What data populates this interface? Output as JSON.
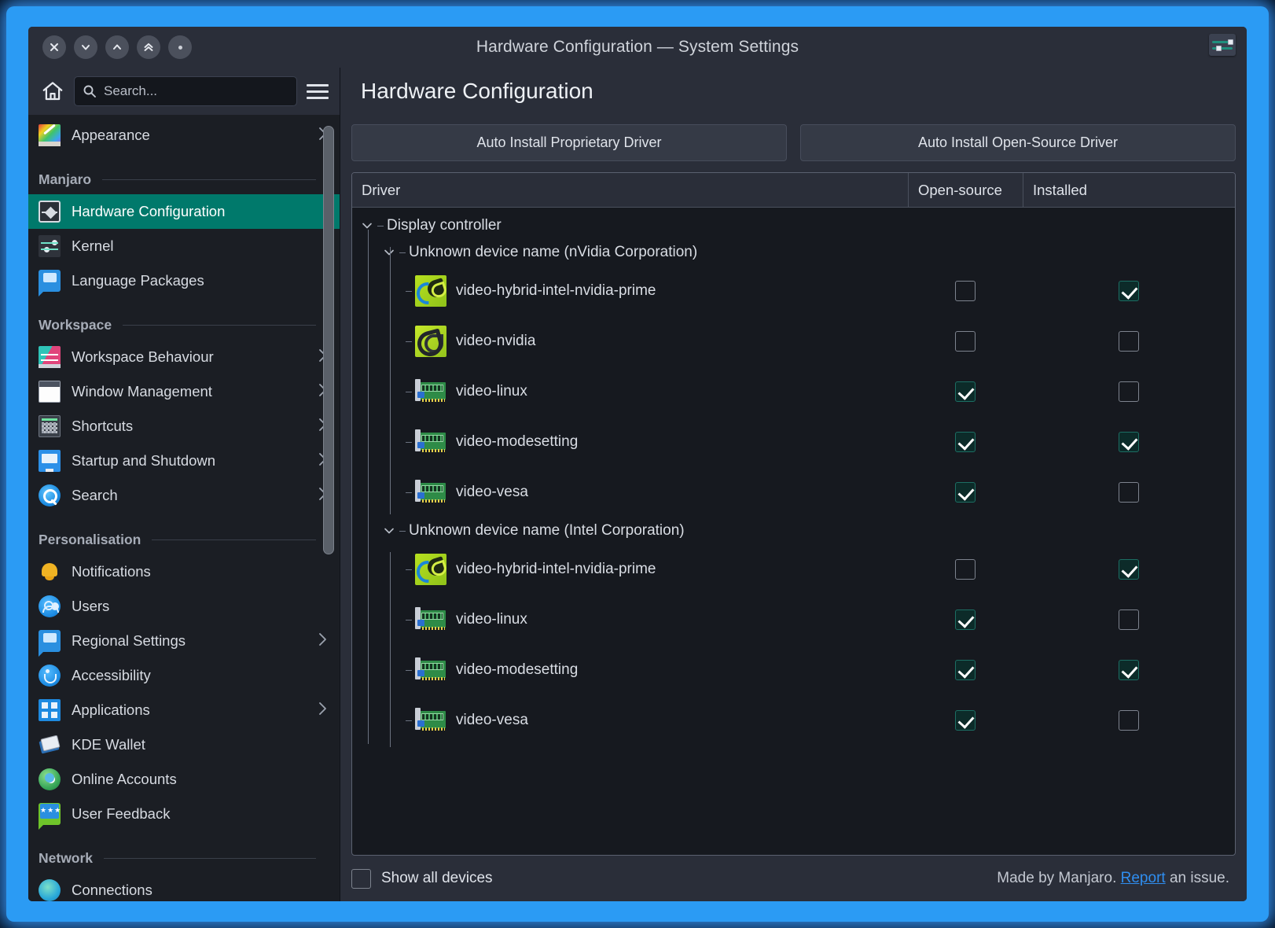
{
  "window": {
    "title": "Hardware Configuration — System Settings",
    "titlebar_buttons": [
      {
        "name": "close-button",
        "glyph": "close-icon"
      },
      {
        "name": "minimize-button",
        "glyph": "chevron-down-icon"
      },
      {
        "name": "maximize-button",
        "glyph": "chevron-up-icon"
      },
      {
        "name": "shade-button",
        "glyph": "double-chevron-up-icon"
      },
      {
        "name": "menu-button",
        "glyph": "dot-icon"
      }
    ],
    "config_icon": "sliders-icon"
  },
  "sidebar": {
    "home_icon": "home-icon",
    "search": {
      "placeholder": "Search...",
      "value": "",
      "icon": "search-icon"
    },
    "menu_icon": "hamburger-icon",
    "sections": [
      {
        "title": "",
        "items": [
          {
            "label": "Appearance",
            "icon": "appearance-icon",
            "chevron": true,
            "selected": false
          }
        ]
      },
      {
        "title": "Manjaro",
        "items": [
          {
            "label": "Hardware Configuration",
            "icon": "hardware-icon",
            "chevron": false,
            "selected": true
          },
          {
            "label": "Kernel",
            "icon": "kernel-icon",
            "chevron": false,
            "selected": false
          },
          {
            "label": "Language Packages",
            "icon": "language-icon",
            "chevron": false,
            "selected": false
          }
        ]
      },
      {
        "title": "Workspace",
        "items": [
          {
            "label": "Workspace Behaviour",
            "icon": "workspace-behaviour-icon",
            "chevron": true,
            "selected": false
          },
          {
            "label": "Window Management",
            "icon": "window-management-icon",
            "chevron": true,
            "selected": false
          },
          {
            "label": "Shortcuts",
            "icon": "keyboard-icon",
            "chevron": true,
            "selected": false
          },
          {
            "label": "Startup and Shutdown",
            "icon": "monitor-icon",
            "chevron": true,
            "selected": false
          },
          {
            "label": "Search",
            "icon": "search-blue-icon",
            "chevron": true,
            "selected": false
          }
        ]
      },
      {
        "title": "Personalisation",
        "items": [
          {
            "label": "Notifications",
            "icon": "bell-icon",
            "chevron": false,
            "selected": false
          },
          {
            "label": "Users",
            "icon": "users-icon",
            "chevron": false,
            "selected": false
          },
          {
            "label": "Regional Settings",
            "icon": "regional-icon",
            "chevron": true,
            "selected": false
          },
          {
            "label": "Accessibility",
            "icon": "accessibility-icon",
            "chevron": false,
            "selected": false
          },
          {
            "label": "Applications",
            "icon": "applications-icon",
            "chevron": true,
            "selected": false
          },
          {
            "label": "KDE Wallet",
            "icon": "wallet-icon",
            "chevron": false,
            "selected": false
          },
          {
            "label": "Online Accounts",
            "icon": "globe-icon",
            "chevron": false,
            "selected": false
          },
          {
            "label": "User Feedback",
            "icon": "feedback-icon",
            "chevron": false,
            "selected": false
          }
        ]
      },
      {
        "title": "Network",
        "items": [
          {
            "label": "Connections",
            "icon": "connections-icon",
            "chevron": false,
            "selected": false
          }
        ]
      }
    ]
  },
  "main": {
    "heading": "Hardware Configuration",
    "buttons": {
      "proprietary": "Auto Install Proprietary Driver",
      "opensource": "Auto Install Open-Source Driver"
    },
    "table": {
      "columns": [
        "Driver",
        "Open-source",
        "Installed"
      ],
      "rows": [
        {
          "level": 0,
          "type": "group",
          "label": "Display controller",
          "expanded": true
        },
        {
          "level": 1,
          "type": "group",
          "label": "Unknown device name (nVidia Corporation)",
          "expanded": true
        },
        {
          "level": 2,
          "type": "driver",
          "label": "video-hybrid-intel-nvidia-prime",
          "icon": "prime-icon",
          "open_source": false,
          "installed": true
        },
        {
          "level": 2,
          "type": "driver",
          "label": "video-nvidia",
          "icon": "nvidia-icon",
          "open_source": false,
          "installed": false
        },
        {
          "level": 2,
          "type": "driver",
          "label": "video-linux",
          "icon": "card-icon",
          "open_source": true,
          "installed": false
        },
        {
          "level": 2,
          "type": "driver",
          "label": "video-modesetting",
          "icon": "card-icon",
          "open_source": true,
          "installed": true
        },
        {
          "level": 2,
          "type": "driver",
          "label": "video-vesa",
          "icon": "card-icon",
          "open_source": true,
          "installed": false
        },
        {
          "level": 1,
          "type": "group",
          "label": "Unknown device name (Intel Corporation)",
          "expanded": true
        },
        {
          "level": 2,
          "type": "driver",
          "label": "video-hybrid-intel-nvidia-prime",
          "icon": "prime-icon",
          "open_source": false,
          "installed": true
        },
        {
          "level": 2,
          "type": "driver",
          "label": "video-linux",
          "icon": "card-icon",
          "open_source": true,
          "installed": false
        },
        {
          "level": 2,
          "type": "driver",
          "label": "video-modesetting",
          "icon": "card-icon",
          "open_source": true,
          "installed": true
        },
        {
          "level": 2,
          "type": "driver",
          "label": "video-vesa",
          "icon": "card-icon",
          "open_source": true,
          "installed": false
        }
      ]
    }
  },
  "footer": {
    "show_all_devices_label": "Show all devices",
    "show_all_devices_checked": false,
    "credit_prefix": "Made by Manjaro. ",
    "credit_link": "Report",
    "credit_suffix": " an issue."
  },
  "colors": {
    "accent": "#00796b",
    "link": "#2f8ef0",
    "window_bg": "#2a2e39",
    "sidebar_bg": "#1b1e24",
    "table_bg": "#16191f",
    "glow": "#2b9bf4"
  }
}
